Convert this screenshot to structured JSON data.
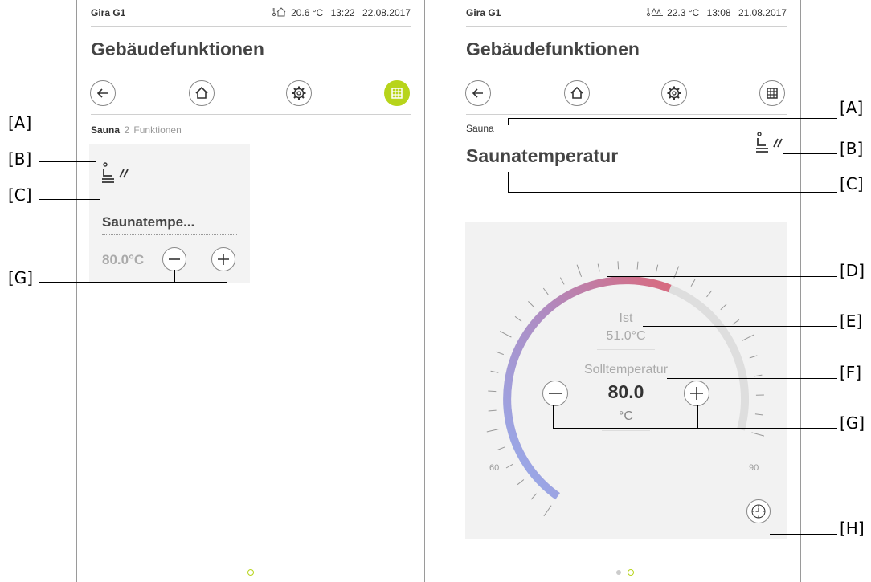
{
  "screen_left": {
    "status": {
      "brand": "Gira G1",
      "temperature": "20.6 °C",
      "time": "13:22",
      "date": "22.08.2017"
    },
    "title": "Gebäudefunktionen",
    "breadcrumb": {
      "room": "Sauna",
      "count": "2",
      "suffix": "Funktionen"
    },
    "tile": {
      "name": "Saunatempe...",
      "value": "80.0°C"
    }
  },
  "screen_right": {
    "status": {
      "brand": "Gira G1",
      "temperature": "22.3 °C",
      "time": "13:08",
      "date": "21.08.2017"
    },
    "title": "Gebäudefunktionen",
    "room": "Sauna",
    "function_title": "Saunatemperatur",
    "dial": {
      "actual_label": "Ist",
      "actual_value": "51.0°C",
      "setpoint_label": "Solltemperatur",
      "setpoint_value": "80.0",
      "unit": "°C",
      "min": "60",
      "max": "90",
      "setpoint_fraction": 0.6667,
      "colors": {
        "cold": "#94aef0",
        "mid": "#b08ac0",
        "hot": "#d96a7e",
        "track": "#dedede"
      }
    }
  },
  "callouts": {
    "A": "[A]",
    "B": "[B]",
    "C": "[C]",
    "D": "[D]",
    "E": "[E]",
    "F": "[F]",
    "G": "[G]",
    "H": "[H]"
  },
  "icons": [
    "back-arrow-icon",
    "home-icon",
    "settings-gear-icon",
    "grid-icon",
    "sauna-icon",
    "minus-icon",
    "plus-icon",
    "clock-icon"
  ],
  "colors": {
    "accent": "#b7d41b"
  }
}
